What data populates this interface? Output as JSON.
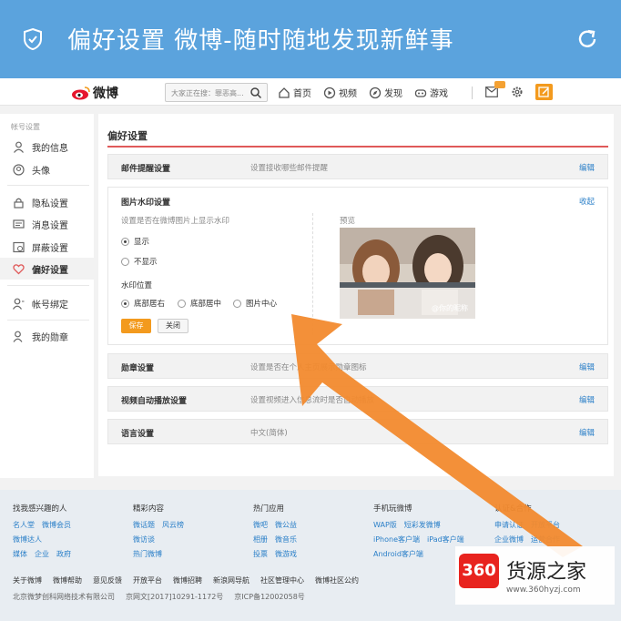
{
  "appbar": {
    "title": "偏好设置 微博-随时随地发现新鲜事"
  },
  "header": {
    "logo_text": "微博",
    "search_placeholder": "大家正在搜：罪恶高...",
    "nav": [
      {
        "label": "首页",
        "icon": "home-icon"
      },
      {
        "label": "视频",
        "icon": "video-icon"
      },
      {
        "label": "发现",
        "icon": "compass-icon"
      },
      {
        "label": "游戏",
        "icon": "game-icon"
      }
    ]
  },
  "sidebar": {
    "group_title": "帐号设置",
    "items": [
      {
        "label": "我的信息",
        "icon": "user-icon"
      },
      {
        "label": "头像",
        "icon": "avatar-icon"
      },
      {
        "label": "隐私设置",
        "icon": "lock-icon"
      },
      {
        "label": "消息设置",
        "icon": "message-icon"
      },
      {
        "label": "屏蔽设置",
        "icon": "block-icon"
      },
      {
        "label": "偏好设置",
        "icon": "heart-icon"
      },
      {
        "label": "帐号绑定",
        "icon": "bind-icon"
      },
      {
        "label": "我的勋章",
        "icon": "medal-icon"
      }
    ]
  },
  "main": {
    "title": "偏好设置",
    "rows": {
      "mail": {
        "title": "邮件提醒设置",
        "desc": "设置接收哪些邮件提醒",
        "edit": "编辑"
      },
      "medal": {
        "title": "勋章设置",
        "desc": "设置是否在个人主页展示勋章图标",
        "edit": "编辑"
      },
      "video": {
        "title": "视频自动播放设置",
        "desc": "设置视频进入信息流时是否自动播放",
        "edit": "编辑"
      },
      "lang": {
        "title": "语言设置",
        "desc": "中文(简体)",
        "edit": "编辑"
      }
    },
    "watermark": {
      "title": "图片水印设置",
      "collapse": "收起",
      "hint": "设置是否在微博图片上显示水印",
      "show": "显示",
      "hide": "不显示",
      "position_label": "水印位置",
      "pos_right": "底部居右",
      "pos_center": "底部居中",
      "pos_middle": "图片中心",
      "save": "保存",
      "close": "关闭",
      "preview_label": "预览",
      "preview_wm": "@你的昵称"
    }
  },
  "footer": {
    "cols": [
      {
        "head": "找我感兴趣的人",
        "lines": [
          [
            "名人堂",
            "微博会员"
          ],
          [
            "微博达人"
          ],
          [
            "媒体",
            "企业",
            "政府"
          ]
        ]
      },
      {
        "head": "精彩内容",
        "lines": [
          [
            "微话题",
            "风云榜"
          ],
          [
            "微访谈"
          ],
          [
            "热门微博"
          ]
        ]
      },
      {
        "head": "热门应用",
        "lines": [
          [
            "微吧",
            "微公益"
          ],
          [
            "相册",
            "微音乐"
          ],
          [
            "投票",
            "微游戏"
          ]
        ]
      },
      {
        "head": "手机玩微博",
        "lines": [
          [
            "WAP版",
            "短彩发微博"
          ],
          [
            "iPhone客户端",
            "iPad客户端"
          ],
          [
            "Android客户端"
          ]
        ]
      },
      {
        "head": "认证&合作",
        "lines": [
          [
            "申请认证",
            "开放平台"
          ],
          [
            "企业微博",
            "运营合作"
          ]
        ]
      }
    ],
    "links": [
      "关于微博",
      "微博帮助",
      "意见反馈",
      "开放平台",
      "微博招聘",
      "新浪网导航",
      "社区管理中心",
      "微博社区公约"
    ],
    "copyright": [
      "北京微梦创科网络技术有限公司",
      "京网文[2017]10291-1172号",
      "京ICP备12002058号"
    ]
  },
  "watermark_logo": {
    "badge": "360",
    "brand": "货源之家",
    "url": "www.360hyzj.com"
  },
  "colors": {
    "appbar": "#5ba3dd",
    "accent_orange": "#f39a1e",
    "arrow": "#f28a2e",
    "link": "#2a7fc8",
    "divider_red": "#e05a5a"
  }
}
